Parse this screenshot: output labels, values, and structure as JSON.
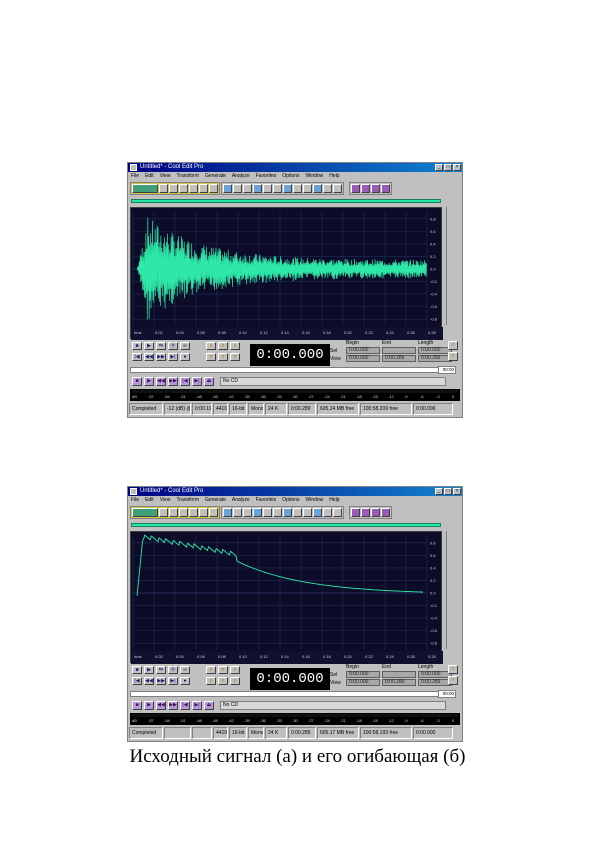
{
  "windows": [
    {
      "title": "Untitled* - Cool Edit Pro",
      "menu": [
        "File",
        "Edit",
        "View",
        "Transform",
        "Generate",
        "Analyze",
        "Favorites",
        "Options",
        "Window",
        "Help"
      ],
      "wave": "noise",
      "ruler": [
        "hms",
        "0.02",
        "0.04",
        "0.06",
        "0.08",
        "0.10",
        "0.12",
        "0.14",
        "0.16",
        "0.18",
        "0.20",
        "0.22",
        "0.24",
        "0.26",
        "0.28"
      ],
      "amp_labels": [
        "0.8",
        "0.6",
        "0.4",
        "0.2",
        "0.0",
        "-0.2",
        "-0.4",
        "-0.6",
        "-0.8"
      ],
      "time": "0:00.000",
      "sel": {
        "begin_hdr": "Begin",
        "end_hdr": "End",
        "length_hdr": "Length",
        "sel_label": "Sel",
        "view_label": "View",
        "sel_begin": "0:00.000",
        "sel_end": "",
        "sel_length": "0:00.000",
        "view_begin": "0:00.000",
        "view_end": "0:00.289",
        "view_length": "0:00.289"
      },
      "small_time": "00:00",
      "cd_status": "No CD",
      "meter_ticks": [
        "dB",
        "-57",
        "-54",
        "-51",
        "-48",
        "-45",
        "-42",
        "-39",
        "-36",
        "-33",
        "-30",
        "-27",
        "-24",
        "-21",
        "-18",
        "-15",
        "-12",
        "-9",
        "-6",
        "-3",
        "0"
      ],
      "status": [
        "Completed",
        "-12 (dB) @",
        "0:00.193",
        "44100",
        "16-bit",
        "Mono",
        "24 K",
        "0:00.289",
        "605.24 MB free",
        "100:58.209 free",
        "0:00.000"
      ]
    },
    {
      "title": "Untitled* - Cool Edit Pro",
      "menu": [
        "File",
        "Edit",
        "View",
        "Transform",
        "Generate",
        "Analyze",
        "Favorites",
        "Options",
        "Window",
        "Help"
      ],
      "wave": "envelope",
      "ruler": [
        "hms",
        "0.02",
        "0.04",
        "0.06",
        "0.08",
        "0.10",
        "0.12",
        "0.14",
        "0.16",
        "0.18",
        "0.20",
        "0.22",
        "0.24",
        "0.26",
        "0.28"
      ],
      "amp_labels": [
        "0.8",
        "0.6",
        "0.4",
        "0.2",
        "0.0",
        "-0.2",
        "-0.4",
        "-0.6",
        "-0.8"
      ],
      "time": "0:00.000",
      "sel": {
        "begin_hdr": "Begin",
        "end_hdr": "End",
        "length_hdr": "Length",
        "sel_label": "Sel",
        "view_label": "View",
        "sel_begin": "0:00.000",
        "sel_end": "",
        "sel_length": "0:00.000",
        "view_begin": "0:00.000",
        "view_end": "0:00.289",
        "view_length": "0:00.289"
      },
      "small_time": "00:00",
      "cd_status": "No CD",
      "meter_ticks": [
        "dB",
        "-57",
        "-54",
        "-51",
        "-48",
        "-45",
        "-42",
        "-39",
        "-36",
        "-33",
        "-30",
        "-27",
        "-24",
        "-21",
        "-18",
        "-15",
        "-12",
        "-9",
        "-6",
        "-3",
        "0"
      ],
      "status": [
        "Completed",
        "",
        "",
        "44100",
        "16-bit",
        "Mono",
        "24 K",
        "0:00.289",
        "605.17 MB free",
        "100:58.193 free",
        "0:00.000"
      ]
    }
  ],
  "caption": "Исходный сигнал (а) и его огибающая (б)"
}
